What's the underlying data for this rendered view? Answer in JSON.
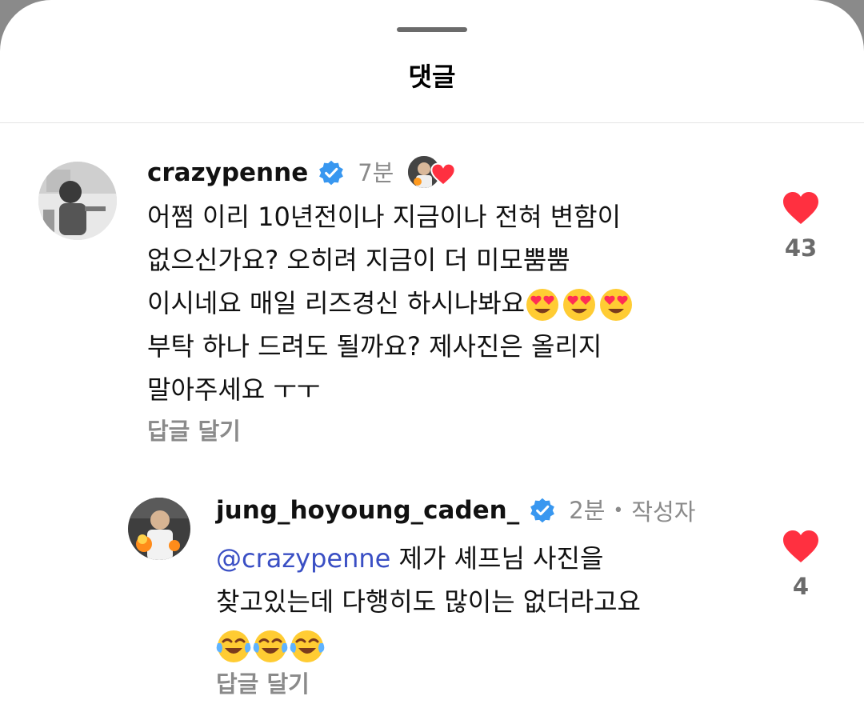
{
  "sheet": {
    "title": "댓글"
  },
  "comments": [
    {
      "username": "crazypenne",
      "time": "7분",
      "lines": [
        "어쩜 이리 10년전이나 지금이나 전혀 변함이",
        "없으신가요? 오히려 지금이 더 미모뿜뿜",
        "이시네요 매일 리즈경신 하시나봐요",
        "부탁 하나 드려도 될까요? 제사진은 올리지",
        "말아주세요 ㅜㅜ"
      ],
      "reply_label": "답글 달기",
      "like_count": "43"
    },
    {
      "username": "jung_hoyoung_caden_",
      "time": "2분",
      "author_label": "작성자",
      "mention": "@crazypenne",
      "lines": [
        " 제가 셰프님 사진을",
        "찾고있는데 다행히도 많이는 없더라고요"
      ],
      "reply_label": "답글 달기",
      "like_count": "4"
    }
  ],
  "colors": {
    "heart": "#ff3040",
    "verified": "#3897f0",
    "secondary_text": "#8a8a8a",
    "mention": "#3a4fc4"
  },
  "icons": {
    "verified": "verified-badge-icon",
    "heart": "heart-icon",
    "heart_eyes": "smiling-face-with-heart-eyes-emoji",
    "joy": "face-with-tears-of-joy-emoji"
  }
}
